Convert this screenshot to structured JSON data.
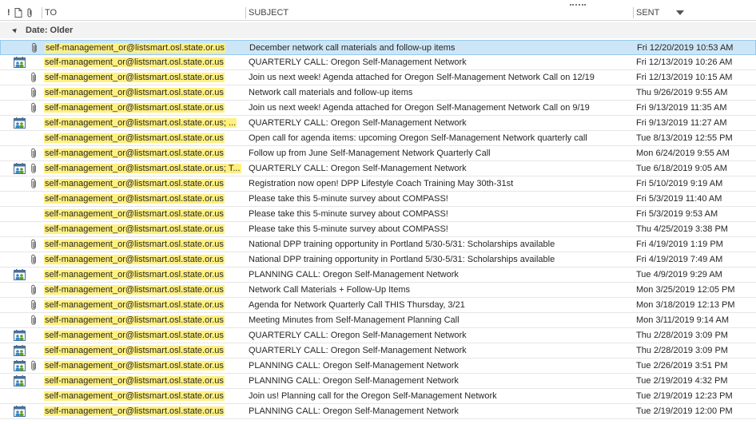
{
  "columns": {
    "importance": "!",
    "icon": "",
    "attachment": "",
    "to": "TO",
    "subject": "SUBJECT",
    "sent": "SENT"
  },
  "group": {
    "label": "Date: Older"
  },
  "rows": [
    {
      "meeting": false,
      "attach": true,
      "to": "self-management_or@listsmart.osl.state.or.us",
      "subject": "December network call materials and follow-up items",
      "sent": "Fri 12/20/2019 10:53 AM",
      "selected": true
    },
    {
      "meeting": true,
      "attach": false,
      "to": "self-management_or@listsmart.osl.state.or.us",
      "subject": "QUARTERLY CALL: Oregon Self-Management Network",
      "sent": "Fri 12/13/2019 10:26 AM"
    },
    {
      "meeting": false,
      "attach": true,
      "to": "self-management_or@listsmart.osl.state.or.us",
      "subject": "Join us next week! Agenda attached for Oregon Self-Management Network Call on 12/19",
      "sent": "Fri 12/13/2019 10:15 AM"
    },
    {
      "meeting": false,
      "attach": true,
      "to": "self-management_or@listsmart.osl.state.or.us",
      "subject": "Network call materials and follow-up items",
      "sent": "Thu 9/26/2019 9:55 AM"
    },
    {
      "meeting": false,
      "attach": true,
      "to": "self-management_or@listsmart.osl.state.or.us",
      "subject": "Join us next week! Agenda attached for Oregon Self-Management Network Call on 9/19",
      "sent": "Fri 9/13/2019 11:35 AM"
    },
    {
      "meeting": true,
      "attach": false,
      "to": "self-management_or@listsmart.osl.state.or.us; ...",
      "subject": "QUARTERLY CALL: Oregon Self-Management Network",
      "sent": "Fri 9/13/2019 11:27 AM"
    },
    {
      "meeting": false,
      "attach": false,
      "to": "self-management_or@listsmart.osl.state.or.us",
      "subject": "Open call for agenda items: upcoming Oregon Self-Management Network quarterly call",
      "sent": "Tue 8/13/2019 12:55 PM"
    },
    {
      "meeting": false,
      "attach": true,
      "to": "self-management_or@listsmart.osl.state.or.us",
      "subject": "Follow up from June Self-Management Network Quarterly Call",
      "sent": "Mon 6/24/2019 9:55 AM"
    },
    {
      "meeting": true,
      "attach": true,
      "to": "self-management_or@listsmart.osl.state.or.us; T...",
      "subject": "QUARTERLY CALL: Oregon Self-Management Network",
      "sent": "Tue 6/18/2019 9:05 AM"
    },
    {
      "meeting": false,
      "attach": true,
      "to": "self-management_or@listsmart.osl.state.or.us",
      "subject": "Registration now open! DPP Lifestyle Coach Training May 30th-31st",
      "sent": "Fri 5/10/2019 9:19 AM"
    },
    {
      "meeting": false,
      "attach": false,
      "to": "self-management_or@listsmart.osl.state.or.us",
      "subject": "Please take this 5-minute survey about COMPASS!",
      "sent": "Fri 5/3/2019 11:40 AM"
    },
    {
      "meeting": false,
      "attach": false,
      "to": "self-management_or@listsmart.osl.state.or.us",
      "subject": "Please take this 5-minute survey about COMPASS!",
      "sent": "Fri 5/3/2019 9:53 AM"
    },
    {
      "meeting": false,
      "attach": false,
      "to": "self-management_or@listsmart.osl.state.or.us",
      "subject": "Please take this 5-minute survey about COMPASS!",
      "sent": "Thu 4/25/2019 3:38 PM"
    },
    {
      "meeting": false,
      "attach": true,
      "to": "self-management_or@listsmart.osl.state.or.us",
      "subject": "National DPP training opportunity in Portland 5/30-5/31: Scholarships available",
      "sent": "Fri 4/19/2019 1:19 PM"
    },
    {
      "meeting": false,
      "attach": true,
      "to": "self-management_or@listsmart.osl.state.or.us",
      "subject": "National DPP training opportunity in Portland 5/30-5/31: Scholarships available",
      "sent": "Fri 4/19/2019 7:49 AM"
    },
    {
      "meeting": true,
      "attach": false,
      "to": "self-management_or@listsmart.osl.state.or.us",
      "subject": "PLANNING CALL: Oregon Self-Management Network",
      "sent": "Tue 4/9/2019 9:29 AM"
    },
    {
      "meeting": false,
      "attach": true,
      "to": "self-management_or@listsmart.osl.state.or.us",
      "subject": "Network Call Materials + Follow-Up Items",
      "sent": "Mon 3/25/2019 12:05 PM"
    },
    {
      "meeting": false,
      "attach": true,
      "to": "self-management_or@listsmart.osl.state.or.us",
      "subject": "Agenda for Network Quarterly Call THIS Thursday, 3/21",
      "sent": "Mon 3/18/2019 12:13 PM"
    },
    {
      "meeting": false,
      "attach": true,
      "to": "self-management_or@listsmart.osl.state.or.us",
      "subject": "Meeting Minutes from Self-Management Planning Call",
      "sent": "Mon 3/11/2019 9:14 AM"
    },
    {
      "meeting": true,
      "attach": false,
      "to": "self-management_or@listsmart.osl.state.or.us",
      "subject": "QUARTERLY CALL: Oregon Self-Management Network",
      "sent": "Thu 2/28/2019 3:09 PM"
    },
    {
      "meeting": true,
      "attach": false,
      "to": "self-management_or@listsmart.osl.state.or.us",
      "subject": "QUARTERLY CALL: Oregon Self-Management Network",
      "sent": "Thu 2/28/2019 3:09 PM"
    },
    {
      "meeting": true,
      "attach": true,
      "to": "self-management_or@listsmart.osl.state.or.us",
      "subject": "PLANNING CALL: Oregon Self-Management Network",
      "sent": "Tue 2/26/2019 3:51 PM"
    },
    {
      "meeting": true,
      "attach": false,
      "to": "self-management_or@listsmart.osl.state.or.us",
      "subject": "PLANNING CALL: Oregon Self-Management Network",
      "sent": "Tue 2/19/2019 4:32 PM"
    },
    {
      "meeting": false,
      "attach": false,
      "to": "self-management_or@listsmart.osl.state.or.us",
      "subject": "Join us! Planning call for the Oregon Self-Management Network",
      "sent": "Tue 2/19/2019 12:23 PM"
    },
    {
      "meeting": true,
      "attach": false,
      "to": "self-management_or@listsmart.osl.state.or.us",
      "subject": "PLANNING CALL: Oregon Self-Management Network",
      "sent": "Tue 2/19/2019 12:00 PM"
    }
  ]
}
